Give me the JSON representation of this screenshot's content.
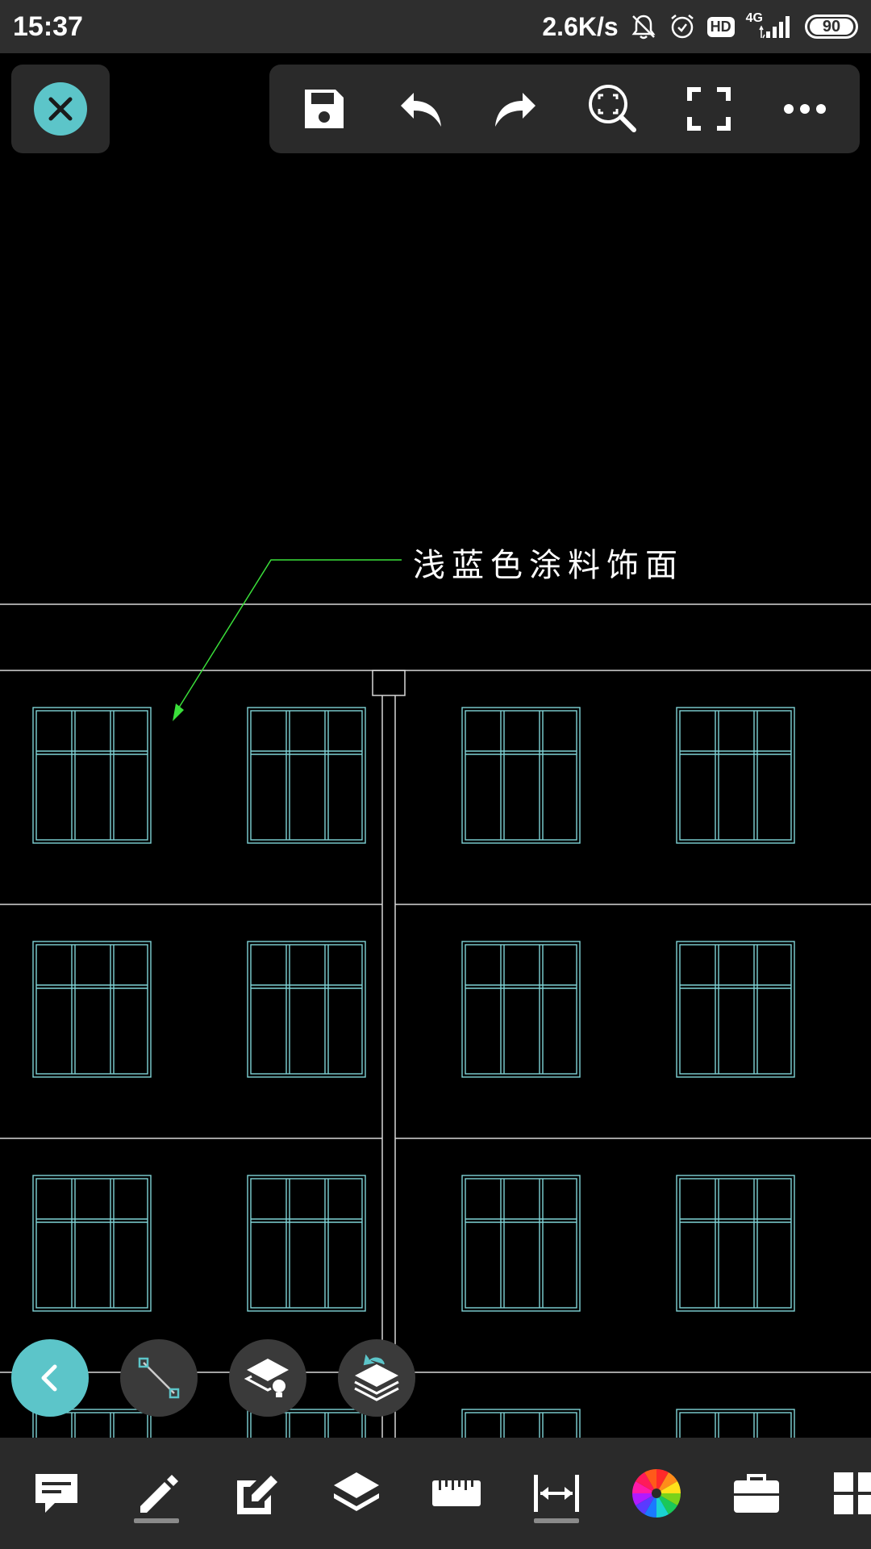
{
  "status_bar": {
    "time": "15:37",
    "net_speed": "2.6K/s",
    "network_type": "4G",
    "hd_label": "HD",
    "battery": "90"
  },
  "top_toolbar": {
    "buttons": [
      "close",
      "save",
      "undo",
      "redo",
      "zoom-extents",
      "fullscreen",
      "more"
    ]
  },
  "drawing": {
    "annotation_label": "浅蓝色涂料饰面",
    "colors": {
      "background": "#000000",
      "window_lines": "#7fd3d6",
      "wall_lines": "#d8d8d8",
      "leader_line": "#3adf3a",
      "accent": "#5cc5c9"
    }
  },
  "floating_tools": [
    "back",
    "line-tool",
    "layer-light",
    "layer-restore"
  ],
  "bottom_toolbar": {
    "tools": [
      "comment",
      "pencil",
      "edit",
      "layers",
      "ruler",
      "dimension",
      "color-wheel",
      "toolbox",
      "grid"
    ]
  }
}
